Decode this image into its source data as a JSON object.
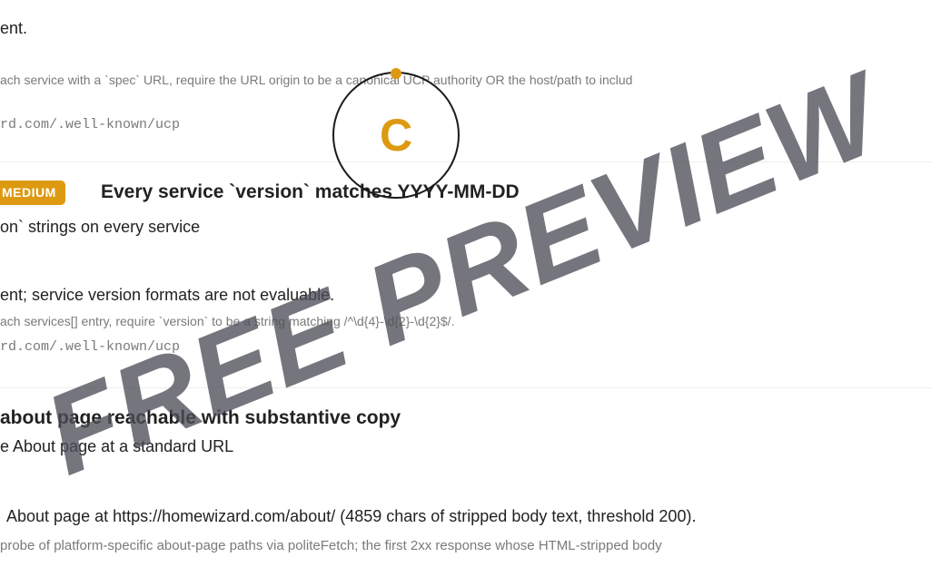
{
  "check1": {
    "result_tail": "ent.",
    "detail": "ach service with a `spec` URL, require the URL origin to be a canonical UCP authority OR the host/path to includ",
    "source": "rd.com/.well-known/ucp"
  },
  "grade": {
    "letter": "C"
  },
  "check2": {
    "badge": "MEDIUM",
    "title": "Every service `version` matches YYYY-MM-DD",
    "subtitle_tail": "on` strings on every service",
    "result_tail": "ent; service version formats are not evaluable.",
    "detail": "ach services[] entry, require `version` to be a string matching /^\\d{4}-\\d{2}-\\d{2}$/.",
    "source": "rd.com/.well-known/ucp"
  },
  "check3": {
    "title": "about page reachable with substantive copy",
    "subtitle_tail": "e About page at a standard URL",
    "result_tail": "About page at https://homewizard.com/about/ (4859 chars of stripped body text, threshold 200).",
    "detail": "probe of platform-specific about-page paths via politeFetch; the first 2xx response whose HTML-stripped body"
  },
  "watermark": {
    "text": "FREE PREVIEW"
  }
}
